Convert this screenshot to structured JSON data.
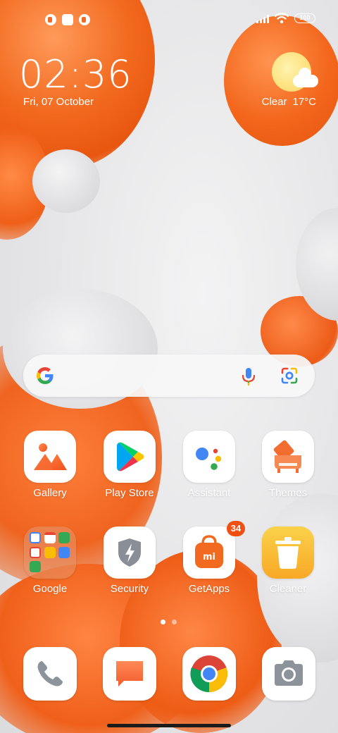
{
  "status_bar": {
    "battery": "100"
  },
  "clock": {
    "time": "02:36",
    "date": "Fri, 07 October"
  },
  "weather": {
    "condition": "Clear",
    "temperature": "17°C",
    "icon": "sun-cloud-icon"
  },
  "search": {
    "icons": [
      "google-g-icon",
      "mic-icon",
      "google-lens-icon"
    ]
  },
  "apps": [
    {
      "label": "Gallery",
      "icon": "gallery-icon"
    },
    {
      "label": "Play Store",
      "icon": "play-store-icon"
    },
    {
      "label": "Assistant",
      "icon": "assistant-icon"
    },
    {
      "label": "Themes",
      "icon": "themes-icon"
    },
    {
      "label": "Google",
      "icon": "folder-icon"
    },
    {
      "label": "Security",
      "icon": "security-shield-icon"
    },
    {
      "label": "GetApps",
      "icon": "getapps-icon",
      "badge": "34"
    },
    {
      "label": "Cleaner",
      "icon": "trash-icon"
    }
  ],
  "page_indicator": {
    "total": 2,
    "current": 1
  },
  "dock": [
    {
      "icon": "phone-icon"
    },
    {
      "icon": "messages-icon"
    },
    {
      "icon": "chrome-icon"
    },
    {
      "icon": "camera-icon"
    }
  ],
  "colors": {
    "accent": "#f26a1f",
    "badge": "#f24f12",
    "cleaner": "#f9b52f"
  }
}
